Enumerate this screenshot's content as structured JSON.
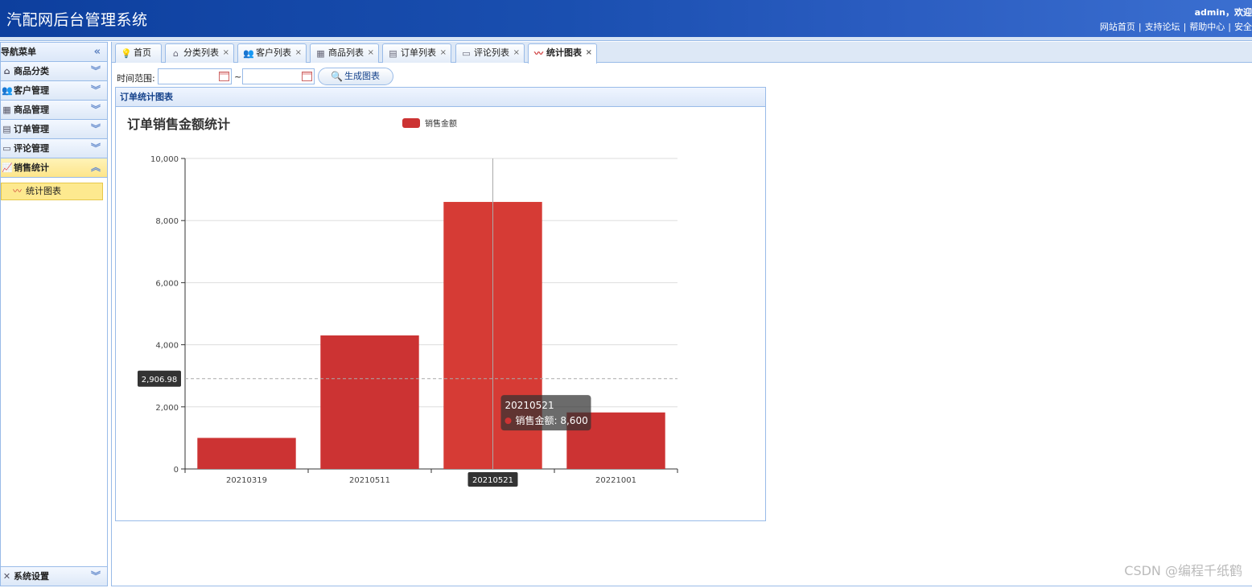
{
  "header": {
    "title": "汽配网后台管理系统",
    "user": "admin，欢迎",
    "links": [
      "网站首页",
      "支持论坛",
      "帮助中心",
      "安全"
    ]
  },
  "sidebar": {
    "title": "导航菜单",
    "items": [
      {
        "label": "商品分类",
        "icon": "tree-icon"
      },
      {
        "label": "客户管理",
        "icon": "users-icon"
      },
      {
        "label": "商品管理",
        "icon": "building-icon"
      },
      {
        "label": "订单管理",
        "icon": "table-icon"
      },
      {
        "label": "评论管理",
        "icon": "comment-icon"
      },
      {
        "label": "销售统计",
        "icon": "chart-icon",
        "active": true
      }
    ],
    "sub_item": "统计图表",
    "bottom_item": "系统设置"
  },
  "tabs": [
    {
      "label": "首页",
      "closable": false
    },
    {
      "label": "分类列表",
      "closable": true
    },
    {
      "label": "客户列表",
      "closable": true
    },
    {
      "label": "商品列表",
      "closable": true
    },
    {
      "label": "订单列表",
      "closable": true
    },
    {
      "label": "评论列表",
      "closable": true
    },
    {
      "label": "统计图表",
      "closable": true,
      "active": true
    }
  ],
  "toolbar": {
    "time_label": "时间范围:",
    "start_value": "",
    "end_value": "",
    "tilde": "~",
    "generate_label": "生成图表"
  },
  "panel": {
    "title": "订单统计图表"
  },
  "chart_data": {
    "type": "bar",
    "title": "订单销售金额统计",
    "legend": "销售金额",
    "categories": [
      "20210319",
      "20210511",
      "20210521",
      "20221001"
    ],
    "series": [
      {
        "name": "销售金额",
        "values": [
          1000,
          4300,
          8600,
          1820
        ]
      }
    ],
    "ylim": [
      0,
      10000
    ],
    "yticks": [
      "0",
      "2,000",
      "4,000",
      "6,000",
      "8,000",
      "10,000"
    ],
    "ytick_values": [
      0,
      2000,
      4000,
      6000,
      8000,
      10000
    ],
    "bar_color": "#cc3333",
    "highlight_color": "#d63b35",
    "highlight_index": 2,
    "crosshair_value": 2906.98,
    "crosshair_label": "2,906.98",
    "tooltip": {
      "title": "20210521",
      "series": "销售金额",
      "value": "8,600"
    }
  },
  "watermark": "CSDN @编程千纸鹤"
}
